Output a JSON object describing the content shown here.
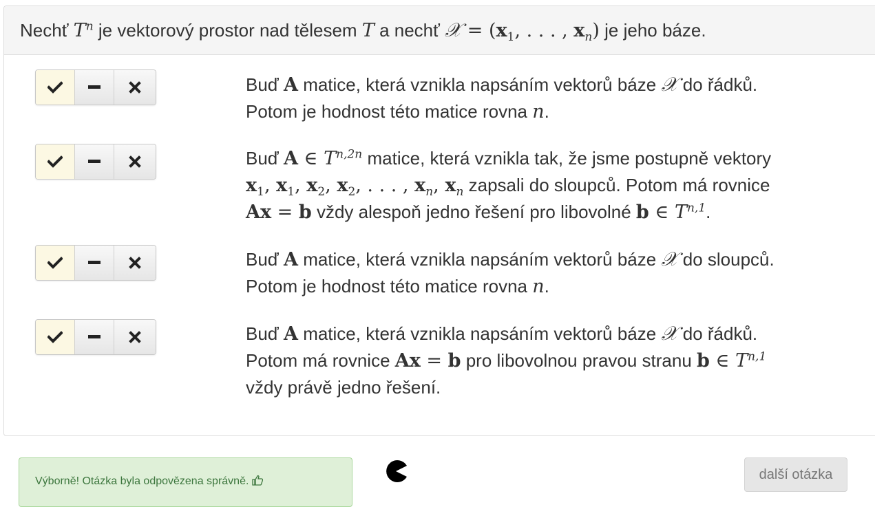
{
  "question": {
    "prefix": "Nechť ",
    "middle1": " je vektorový prostor nad tělesem ",
    "middle2": " a nechť ",
    "suffix": " je jeho báze."
  },
  "toggle_icons": [
    "check-icon",
    "minus-icon",
    "times-icon"
  ],
  "items": [
    {
      "state": "true",
      "text_a": "Buď ",
      "text_b": " matice, která vznikla napsáním vektorů báze ",
      "text_c": " do řádků.",
      "text_d": "Potom je hodnost této matice rovna ",
      "text_e": "."
    },
    {
      "state": "true",
      "text_a": "Buď ",
      "text_b": " matice, která vznikla tak, že jsme postupně vektory",
      "text_c": " zapsali do sloupců. Potom má rovnice",
      "text_d": " vždy alespoň jedno řešení pro libovolné ",
      "text_e": "."
    },
    {
      "state": "true",
      "text_a": "Buď ",
      "text_b": " matice, která vznikla napsáním vektorů báze ",
      "text_c": " do sloupců.",
      "text_d": "Potom je hodnost této matice rovna ",
      "text_e": "."
    },
    {
      "state": "true",
      "text_a": "Buď ",
      "text_b": " matice, která vznikla napsáním vektorů báze ",
      "text_c": " do řádků.",
      "text_d": "Potom má rovnice ",
      "text_e": " pro libovolnou pravou stranu ",
      "text_f": "vždy právě jedno řešení."
    }
  ],
  "feedback": {
    "message": "Výborně! Otázka byla odpovězena správně.",
    "icon": "thumbs-up-icon"
  },
  "next_button": "další otázka",
  "colors": {
    "selected_toggle": "#fcf8e3",
    "success_bg": "#dff0d8",
    "success_text": "#3c763d"
  }
}
